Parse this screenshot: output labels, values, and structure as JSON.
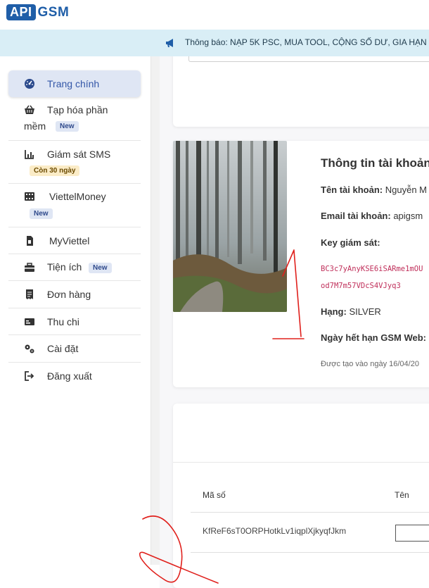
{
  "header": {
    "logo_api": "API",
    "logo_gsm": "GSM"
  },
  "notice": {
    "icon": "megaphone-icon",
    "text": "Thông báo: NẠP 5K PSC, MUA TOOL, CỘNG SỐ DƯ, GIA HẠN T"
  },
  "sidebar": {
    "items": [
      {
        "label": "Trang chính",
        "icon": "dashboard-icon"
      },
      {
        "label": "Tạp hóa phần",
        "label2": "mềm",
        "badge": "New",
        "icon": "basket-icon"
      },
      {
        "label": "Giám sát SMS",
        "badge": "Còn 30 ngày",
        "icon": "chart-icon"
      },
      {
        "label": "ViettelMoney",
        "badge": "New",
        "icon": "film-icon"
      },
      {
        "label": "MyViettel",
        "icon": "sim-icon"
      },
      {
        "label": "Tiện ích",
        "badge": "New",
        "icon": "toolbox-icon"
      },
      {
        "label": "Đơn hàng",
        "icon": "receipt-icon"
      },
      {
        "label": "Thu chi",
        "icon": "money-icon"
      },
      {
        "label": "Cài đặt",
        "icon": "gears-icon"
      },
      {
        "label": "Đăng xuất",
        "icon": "logout-icon"
      }
    ]
  },
  "account": {
    "title": "Thông tin tài khoản",
    "name_label": "Tên tài khoản:",
    "name_value": "Nguyễn M",
    "email_label": "Email tài khoản:",
    "email_value": "apigsm",
    "key_label": "Key giám sát:",
    "key_line1": "BC3c7yAnyKSE6iSARme1mOU",
    "key_line2": "od7M7m57VDcS4VJyq3",
    "rank_label": "Hạng:",
    "rank_value": "SILVER",
    "expiry_label": "Ngày hết hạn GSM Web:",
    "created": "Được tạo vào ngày 16/04/20"
  },
  "table": {
    "col_code": "Mã số",
    "col_name": "Tên",
    "row_code": "KfReF6sT0ORPHotkLv1iqplXjkyqfJkm"
  },
  "colors": {
    "brand": "#1f5ea8",
    "notice_bg": "#d9eef6",
    "active_bg": "#dfe6f4",
    "key_text": "#c0305b",
    "annotation": "#e0201c"
  }
}
